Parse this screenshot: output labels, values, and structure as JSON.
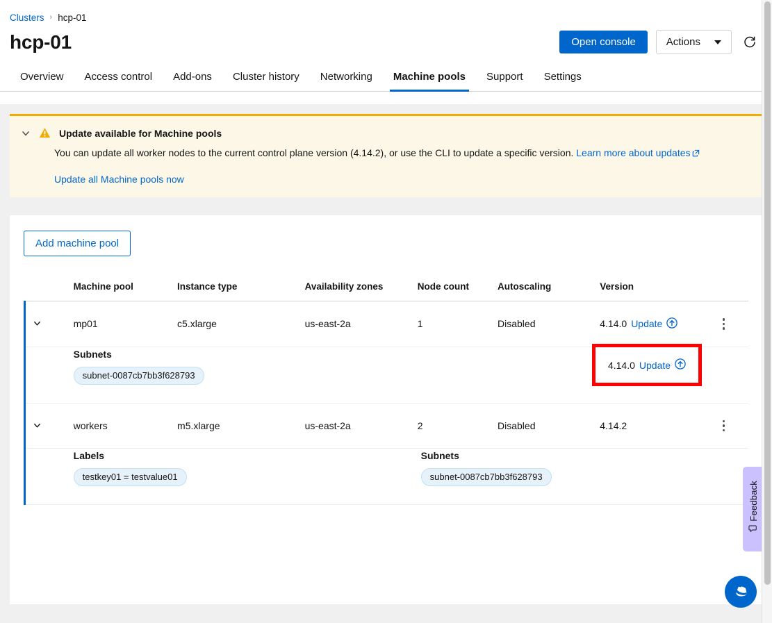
{
  "breadcrumb": {
    "root": "Clusters",
    "separator": "›",
    "current": "hcp-01"
  },
  "header": {
    "title": "hcp-01",
    "open_console_label": "Open console",
    "actions_label": "Actions",
    "refresh_icon": "refresh-icon",
    "caret_icon": "chevron-down-icon"
  },
  "tabs": [
    {
      "label": "Overview",
      "active": false
    },
    {
      "label": "Access control",
      "active": false
    },
    {
      "label": "Add-ons",
      "active": false
    },
    {
      "label": "Cluster history",
      "active": false
    },
    {
      "label": "Networking",
      "active": false
    },
    {
      "label": "Machine pools",
      "active": true
    },
    {
      "label": "Support",
      "active": false
    },
    {
      "label": "Settings",
      "active": false
    }
  ],
  "alert": {
    "icon": "warning-triangle-icon",
    "toggle_icon": "chevron-down-icon",
    "title": "Update available for Machine pools",
    "description": "You can update all worker nodes to the current control plane version (4.14.2), or use the CLI to update a specific version.",
    "learn_more_label": "Learn more about updates",
    "external_icon": "external-link-icon",
    "action_label": "Update all Machine pools now",
    "accent_color": "#f0ab00",
    "background_color": "#fdf7e7"
  },
  "toolbar": {
    "add_machine_pool_label": "Add machine pool"
  },
  "table": {
    "columns": [
      "",
      "Machine pool",
      "Instance type",
      "Availability zones",
      "Node count",
      "Autoscaling",
      "Version",
      ""
    ],
    "rows": [
      {
        "toggle_icon": "chevron-down-icon",
        "name": "mp01",
        "instance_type": "c5.xlarge",
        "availability_zones": "us-east-2a",
        "node_count": "1",
        "autoscaling": "Disabled",
        "version": "4.14.0",
        "update_label": "Update",
        "update_icon": "arrow-circle-up-icon",
        "kebab_icon": "kebab-menu-icon",
        "highlighted": true,
        "details": [
          {
            "label": "Subnets",
            "chips": [
              "subnet-0087cb7bb3f628793"
            ]
          }
        ]
      },
      {
        "toggle_icon": "chevron-down-icon",
        "name": "workers",
        "instance_type": "m5.xlarge",
        "availability_zones": "us-east-2a",
        "node_count": "2",
        "autoscaling": "Disabled",
        "version": "4.14.2",
        "update_label": "",
        "kebab_icon": "kebab-menu-icon",
        "highlighted": false,
        "details": [
          {
            "label": "Labels",
            "chips": [
              "testkey01 = testvalue01"
            ]
          },
          {
            "label": "Subnets",
            "chips": [
              "subnet-0087cb7bb3f628793"
            ]
          }
        ]
      }
    ]
  },
  "feedback": {
    "label": "Feedback",
    "icon": "comment-icon",
    "color": "#cbc1ff"
  },
  "assistant": {
    "icon": "redhat-logo-icon",
    "color": "#0066cc"
  },
  "colors": {
    "accent_blue": "#0066cc",
    "highlight_red": "#ff0000",
    "page_background": "#f0f0f0"
  }
}
